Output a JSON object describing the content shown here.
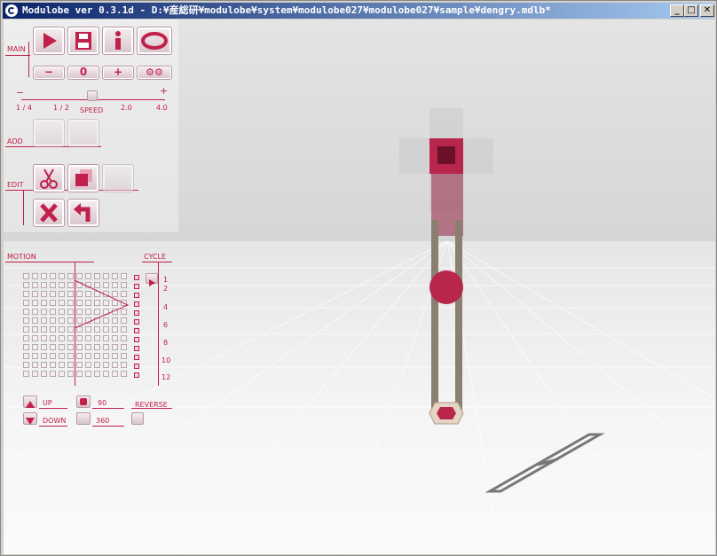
{
  "window": {
    "title": "Modulobe ver 0.3.1d - D:¥産総研¥modulobe¥system¥modulobe027¥modulobe027¥sample¥dengry.mdlb*",
    "minimize_label": "_",
    "maximize_label": "□",
    "close_label": "✕"
  },
  "panel": {
    "main_label": "MAIN",
    "add_label": "ADD",
    "edit_label": "EDIT",
    "motion_label": "MOTION",
    "cycle_label": "CYCLE",
    "zero_label": "0",
    "minus_label": "−",
    "plus_label": "+",
    "speed": {
      "label": "SPEED",
      "minus": "−",
      "plus": "+",
      "ticks": [
        "1 / 4",
        "1 / 2",
        "2.0",
        "4.0"
      ]
    },
    "cycle_numbers": [
      "1",
      "2",
      "4",
      "6",
      "8",
      "10",
      "12"
    ],
    "up_label": "UP",
    "down_label": "DOWN",
    "reverse_label": "REVERSE",
    "angle_90": "90",
    "angle_360": "360"
  },
  "icons": {
    "play": "play-icon",
    "save": "save-icon",
    "info": "info-icon",
    "view": "eye-icon",
    "settings": "gear-icon",
    "cut": "scissors-icon",
    "copy": "copy-icon",
    "delete": "cross-icon",
    "undo": "undo-icon"
  },
  "colors": {
    "accent": "#c0204a",
    "joint": "#b8264c",
    "rod": "#8a7f70"
  }
}
